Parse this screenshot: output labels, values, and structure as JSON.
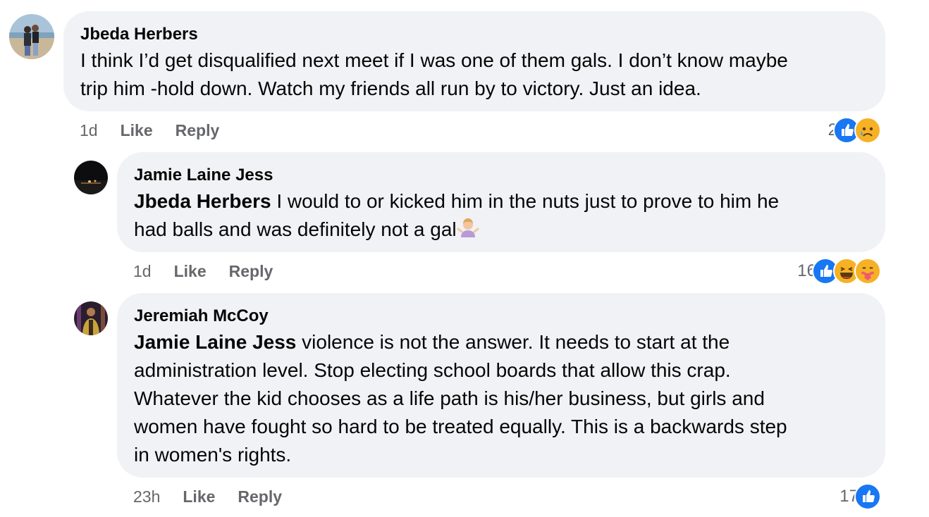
{
  "comments": [
    {
      "author": "Jbeda Herbers",
      "mention": "",
      "text_line1": "I think I’d get disqualified next meet if I was one of them gals. I don’t know maybe",
      "text_line2": "trip him -hold down. Watch my friends all run by to victory. Just an idea.",
      "time": "1d",
      "like_label": "Like",
      "reply_label": "Reply",
      "reaction_count": "2",
      "reactions": [
        "like-icon",
        "sad-icon"
      ]
    },
    {
      "author": "Jamie Laine Jess",
      "mention": "Jbeda Herbers",
      "text_line1": " I would to or kicked him in the nuts just to prove to him he",
      "text_line2": "had balls and was definitely not a gal",
      "trailing_emoji": "woman-shrugging-emoji",
      "time": "1d",
      "like_label": "Like",
      "reply_label": "Reply",
      "reaction_count": "16",
      "reactions": [
        "like-icon",
        "haha-icon",
        "care-icon"
      ]
    },
    {
      "author": "Jeremiah McCoy",
      "mention": "Jamie Laine Jess",
      "text_line1": " violence is not the answer. It needs to start at the",
      "text_line2": "administration level. Stop electing school boards that allow this crap.",
      "text_line3": "Whatever the kid chooses as a life path is his/her business, but girls and",
      "text_line4": "women have fought so hard to be treated equally. This is a backwards step",
      "text_line5": "in women's rights.",
      "time": "23h",
      "like_label": "Like",
      "reply_label": "Reply",
      "reaction_count": "17",
      "reactions": [
        "like-icon"
      ]
    }
  ],
  "colors": {
    "bubble": "#f0f2f5",
    "meta": "#65676b",
    "like": "#1877f2",
    "emoji": "#f7b125"
  }
}
